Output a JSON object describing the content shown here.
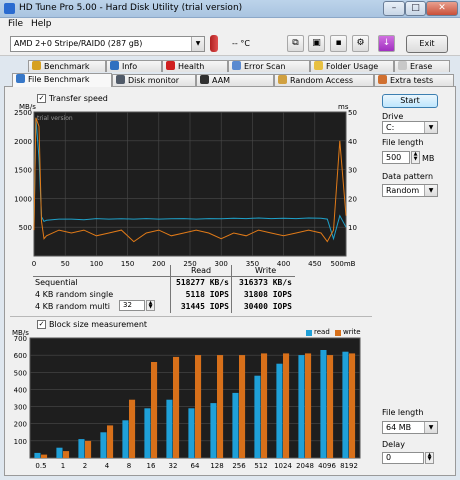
{
  "window": {
    "title": "HD Tune Pro 5.00 - Hard Disk Utility (trial version)",
    "minimize": "–",
    "maximize": "□",
    "close": "✕"
  },
  "menu": {
    "file": "File",
    "help": "Help"
  },
  "toolbar": {
    "drive_select": "AMD      2+0 Stripe/RAID0 (287 gB)",
    "temperature": "-- °C",
    "exit_label": "Exit",
    "icons": [
      "copy-icon",
      "copy-screen-icon",
      "save-icon",
      "options-icon",
      "download-icon"
    ]
  },
  "tabs_row1": [
    "Benchmark",
    "Info",
    "Health",
    "Error Scan",
    "Folder Usage",
    "Erase"
  ],
  "tabs_row2": [
    "File Benchmark",
    "Disk monitor",
    "AAM",
    "Random Access",
    "Extra tests"
  ],
  "active_tab": "File Benchmark",
  "transfer": {
    "checkbox_label": "Transfer speed",
    "checked": true,
    "left_unit": "MB/s",
    "right_unit": "ms",
    "watermark": "trial version",
    "y_left_ticks": [
      "2500",
      "2000",
      "1500",
      "1000",
      "500"
    ],
    "y_right_ticks": [
      "50",
      "40",
      "30",
      "20",
      "10"
    ],
    "x_ticks": [
      "0",
      "50",
      "100",
      "150",
      "200",
      "250",
      "300",
      "350",
      "400",
      "450",
      "500mB"
    ]
  },
  "chart_data": [
    {
      "type": "line",
      "title": "Transfer speed",
      "x": [
        0,
        3,
        8,
        12,
        16,
        20,
        40,
        60,
        80,
        100,
        120,
        140,
        160,
        180,
        200,
        220,
        240,
        260,
        280,
        300,
        320,
        340,
        360,
        380,
        400,
        420,
        440,
        460,
        470,
        480,
        490,
        500
      ],
      "xlabel": "mB",
      "ylabel": "MB/s",
      "ylim": [
        0,
        2500
      ],
      "y2lim": [
        0,
        50
      ],
      "series": [
        {
          "axis": "left",
          "color": "#1fa0c8",
          "values": [
            560,
            2400,
            1700,
            680,
            600,
            620,
            640,
            640,
            630,
            650,
            640,
            645,
            640,
            650,
            640,
            645,
            650,
            640,
            650,
            645,
            655,
            650,
            660,
            650,
            655,
            650,
            660,
            655,
            640,
            300,
            700,
            500
          ]
        },
        {
          "axis": "right",
          "color": "#e07a18",
          "values": [
            9,
            48,
            45,
            12,
            6,
            7,
            9,
            8,
            9,
            7,
            8,
            9,
            5,
            8,
            9,
            7,
            8,
            9,
            8,
            6,
            8,
            7,
            9,
            8,
            7,
            8,
            9,
            8,
            5,
            9,
            40,
            14
          ]
        }
      ]
    },
    {
      "type": "bar",
      "title": "Block size measurement",
      "categories": [
        "0.5",
        "1",
        "2",
        "4",
        "8",
        "16",
        "32",
        "64",
        "128",
        "256",
        "512",
        "1024",
        "2048",
        "4096",
        "8192"
      ],
      "ylim": [
        0,
        700
      ],
      "ylabel": "MB/s",
      "series": [
        {
          "name": "read",
          "color": "#1fa0d8",
          "values": [
            30,
            60,
            110,
            150,
            220,
            290,
            340,
            290,
            320,
            380,
            480,
            550,
            600,
            630,
            620
          ]
        },
        {
          "name": "write",
          "color": "#d8701a",
          "values": [
            20,
            40,
            100,
            190,
            340,
            560,
            590,
            600,
            600,
            600,
            610,
            610,
            610,
            600,
            610
          ]
        }
      ]
    }
  ],
  "results": {
    "headers": [
      "Read",
      "Write"
    ],
    "rows": [
      {
        "label": "Sequential",
        "read": "518277 KB/s",
        "write": "316373 KB/s"
      },
      {
        "label": "4 KB random single",
        "read": "5118 IOPS",
        "write": "31808 IOPS"
      },
      {
        "label": "4 KB random multi",
        "qd": "32",
        "read": "31445 IOPS",
        "write": "30400 IOPS"
      }
    ]
  },
  "blocks": {
    "checkbox_label": "Block size measurement",
    "checked": true,
    "unit": "MB/s",
    "y_ticks": [
      "700",
      "600",
      "500",
      "400",
      "300",
      "200",
      "100"
    ],
    "legend_read": "read",
    "legend_write": "write"
  },
  "sidebar": {
    "start_label": "Start",
    "drive_label": "Drive",
    "drive_value": "C:",
    "file_length_label": "File length",
    "file_length_value": "500",
    "file_length_unit": "MB",
    "data_pattern_label": "Data pattern",
    "data_pattern_value": "Random",
    "file_length2_label": "File length",
    "file_length2_value": "64 MB",
    "delay_label": "Delay",
    "delay_value": "0"
  }
}
